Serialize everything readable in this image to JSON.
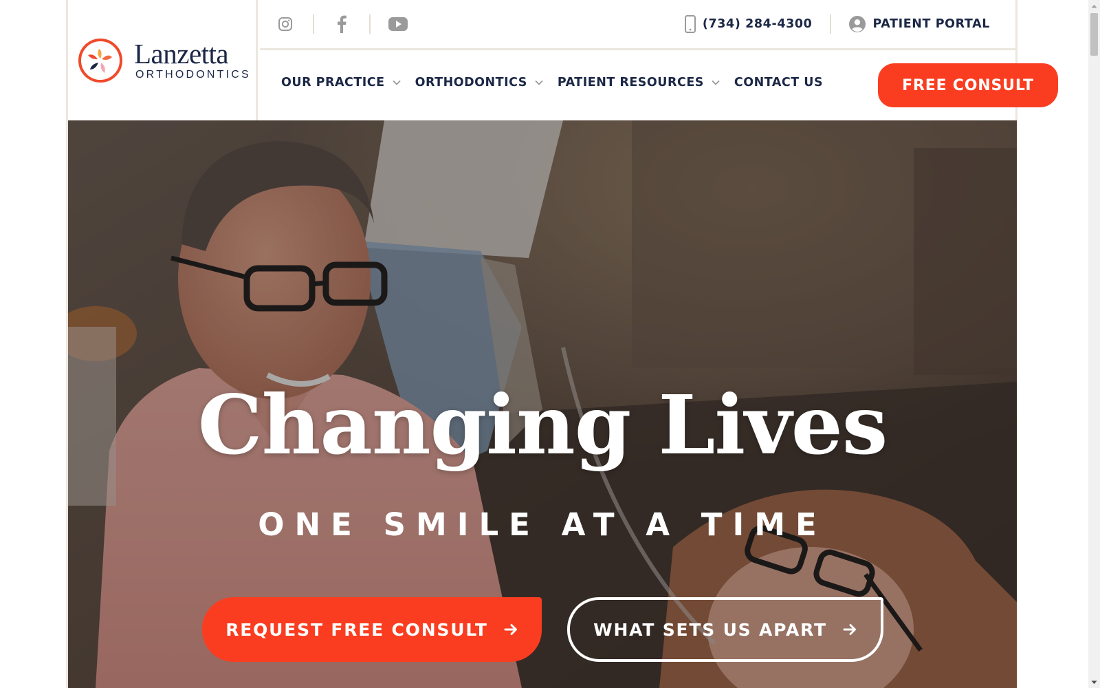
{
  "brand": {
    "name": "Lanzetta",
    "subtitle": "ORTHODONTICS",
    "logo_colors": [
      "#f04a2b",
      "#f7a53a",
      "#1b2746",
      "#f2a7b6",
      "#f36b3f"
    ]
  },
  "topbar": {
    "social": [
      {
        "icon": "instagram-icon"
      },
      {
        "icon": "facebook-icon"
      },
      {
        "icon": "youtube-icon"
      }
    ],
    "phone": "(734) 284-4300",
    "portal": "PATIENT PORTAL"
  },
  "nav": {
    "items": [
      {
        "label": "OUR PRACTICE",
        "dropdown": true
      },
      {
        "label": "ORTHODONTICS",
        "dropdown": true
      },
      {
        "label": "PATIENT RESOURCES",
        "dropdown": true
      },
      {
        "label": "CONTACT US",
        "dropdown": false
      }
    ],
    "cta": "FREE CONSULT"
  },
  "hero": {
    "title": "Changing Lives",
    "subtitle": "ONE SMILE AT A TIME",
    "primary_button": "REQUEST FREE CONSULT",
    "secondary_button": "WHAT SETS US APART"
  },
  "colors": {
    "accent": "#fa3d20",
    "navy": "#1b2746",
    "border": "#ece7df",
    "icon_gray": "#9a9a9a"
  }
}
